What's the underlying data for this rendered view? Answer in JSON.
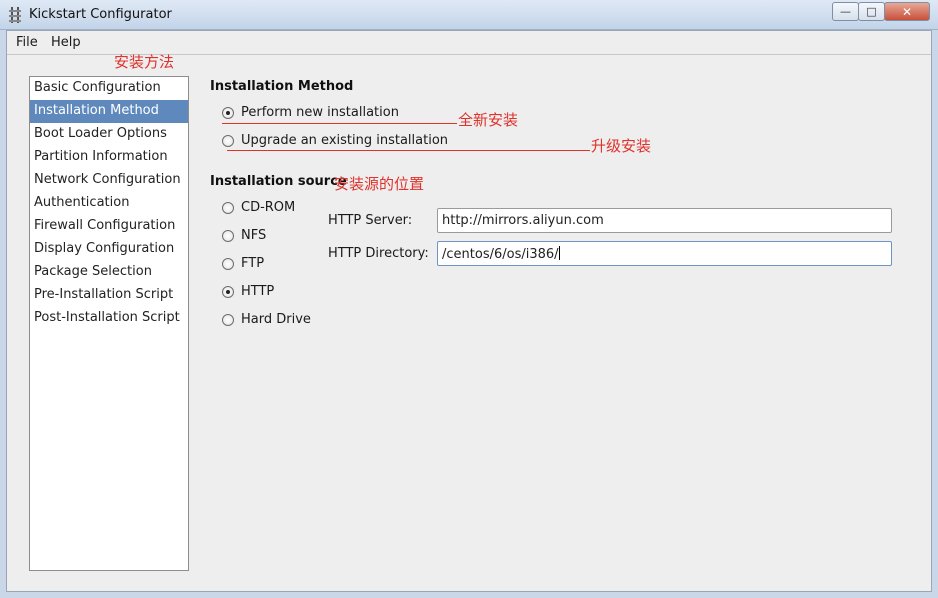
{
  "window": {
    "title": "Kickstart Configurator",
    "minimize_icon": "minimize-icon",
    "maximize_icon": "maximize-icon",
    "close_icon": "close-icon"
  },
  "menu": {
    "file": "File",
    "help": "Help"
  },
  "sidebar": {
    "items": [
      {
        "label": "Basic Configuration"
      },
      {
        "label": "Installation Method"
      },
      {
        "label": "Boot Loader Options"
      },
      {
        "label": "Partition Information"
      },
      {
        "label": "Network Configuration"
      },
      {
        "label": "Authentication"
      },
      {
        "label": "Firewall Configuration"
      },
      {
        "label": "Display Configuration"
      },
      {
        "label": "Package Selection"
      },
      {
        "label": "Pre-Installation Script"
      },
      {
        "label": "Post-Installation Script"
      }
    ],
    "selected": "Installation Method"
  },
  "install_method": {
    "title": "Installation Method",
    "options": [
      {
        "label": "Perform new installation",
        "checked": true
      },
      {
        "label": "Upgrade an existing installation",
        "checked": false
      }
    ]
  },
  "install_source": {
    "title": "Installation source",
    "options": [
      {
        "label": "CD-ROM",
        "checked": false
      },
      {
        "label": "NFS",
        "checked": false
      },
      {
        "label": "FTP",
        "checked": false
      },
      {
        "label": "HTTP",
        "checked": true
      },
      {
        "label": "Hard Drive",
        "checked": false
      }
    ],
    "http_server_label": "HTTP Server:",
    "http_server_value": "http://mirrors.aliyun.com",
    "http_directory_label": "HTTP Directory:",
    "http_directory_value": "/centos/6/os/i386/"
  },
  "annotations": {
    "install_method": "安装方法",
    "new_install": "全新安装",
    "upgrade_install": "升级安装",
    "source_location": "安装源的位置",
    "color": "#e0322c"
  },
  "colors": {
    "selected_bg": "#5f89bc",
    "window_bg": "#eeeeee"
  }
}
